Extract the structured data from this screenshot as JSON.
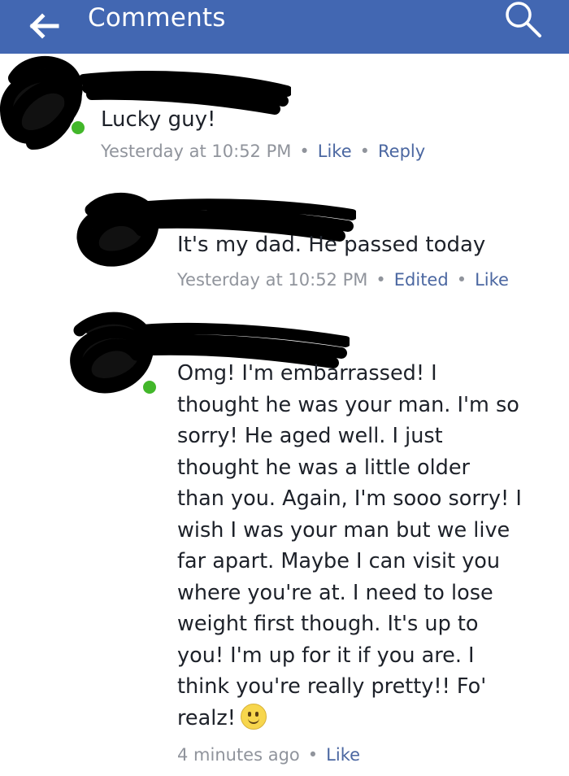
{
  "header": {
    "title": "Comments",
    "background_color": "#4267b2",
    "back_icon": "arrow-left-icon",
    "search_icon": "search-icon"
  },
  "comments": [
    {
      "text": "Lucky guy!",
      "timestamp": "Yesterday at 10:52 PM",
      "actions": [
        "Like",
        "Reply"
      ]
    },
    {
      "text": "It's my dad. He passed today",
      "timestamp": "Yesterday at 10:52 PM",
      "actions": [
        "Edited",
        "Like"
      ]
    },
    {
      "text_lines": [
        "Omg! I'm embarrassed! I",
        "thought he was your man. I'm so",
        "sorry! He aged well. I just",
        "thought he was a little older",
        "than you. Again, I'm sooo sorry! I",
        "wish I was your man but we live",
        "far apart. Maybe I can visit you",
        "where you're at. I need to lose",
        "weight first though. It's up to",
        "you! I'm up for it if you are. I",
        "think you're really pretty!! Fo'",
        "realz!"
      ],
      "emoji": "smiley-emoji",
      "timestamp": "4 minutes ago",
      "actions": [
        "Like"
      ]
    }
  ],
  "colors": {
    "link": "#4b67a1",
    "meta": "#90949c",
    "online": "#42b72a",
    "redaction": "#000000"
  }
}
